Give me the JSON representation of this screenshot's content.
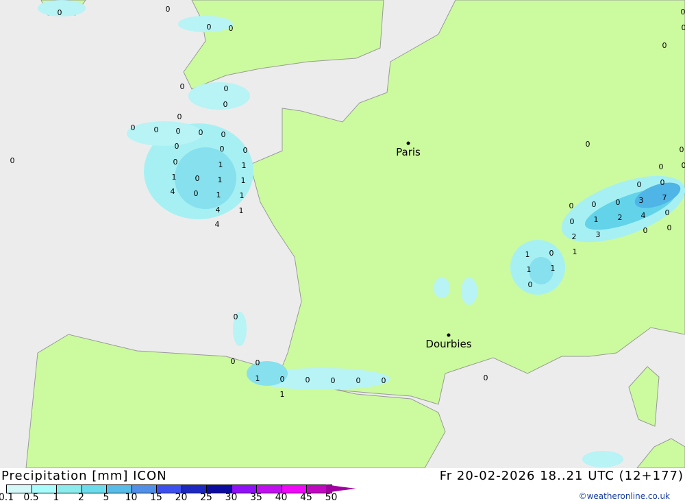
{
  "title": "Precipitation [mm] ICON",
  "datetime": "Fr 20-02-2026 18..21 UTC (12+177)",
  "credit": "©weatheronline.co.uk",
  "colors": {
    "land": "#ccfa9e",
    "sea": "#ececec",
    "border": "#999999",
    "precip_light": "#c9f5f5",
    "precip_mid": "#9be9ef",
    "precip_heavy": "#63d3ea",
    "precip_strong": "#4fb4e6"
  },
  "legend": {
    "ticks": [
      "0.1",
      "0.5",
      "1",
      "2",
      "5",
      "10",
      "15",
      "20",
      "25",
      "30",
      "35",
      "40",
      "45",
      "50"
    ],
    "colors": [
      "#d4f8f8",
      "#a8fcfc",
      "#8aecec",
      "#6adcec",
      "#58bce8",
      "#5090e8",
      "#3c50f0",
      "#1c28c0",
      "#0c0ca0",
      "#9010f8",
      "#c010f0",
      "#f008f8",
      "#c008c0"
    ]
  },
  "cities": [
    {
      "name": "Paris"
    },
    {
      "name": "Dourbies"
    }
  ],
  "precip_labels": [
    "0",
    "0",
    "0",
    "0",
    "0",
    "0",
    "0",
    "0",
    "0",
    "0",
    "0",
    "0",
    "0",
    "0",
    "0",
    "0",
    "0",
    "0",
    "0",
    "0",
    "0",
    "0",
    "0",
    "1",
    "1",
    "0",
    "0",
    "1",
    "0",
    "1",
    "1",
    "0",
    "0",
    "4",
    "0",
    "1",
    "1",
    "0",
    "0",
    "0",
    "3",
    "7",
    "4",
    "1",
    "0",
    "0",
    "1",
    "2",
    "4",
    "4",
    "0",
    "0",
    "2",
    "3",
    "1",
    "0",
    "1",
    "1",
    "1",
    "0",
    "0",
    "0",
    "0",
    "1",
    "0",
    "0",
    "0",
    "0",
    "0",
    "0",
    "1",
    "0",
    "0"
  ]
}
